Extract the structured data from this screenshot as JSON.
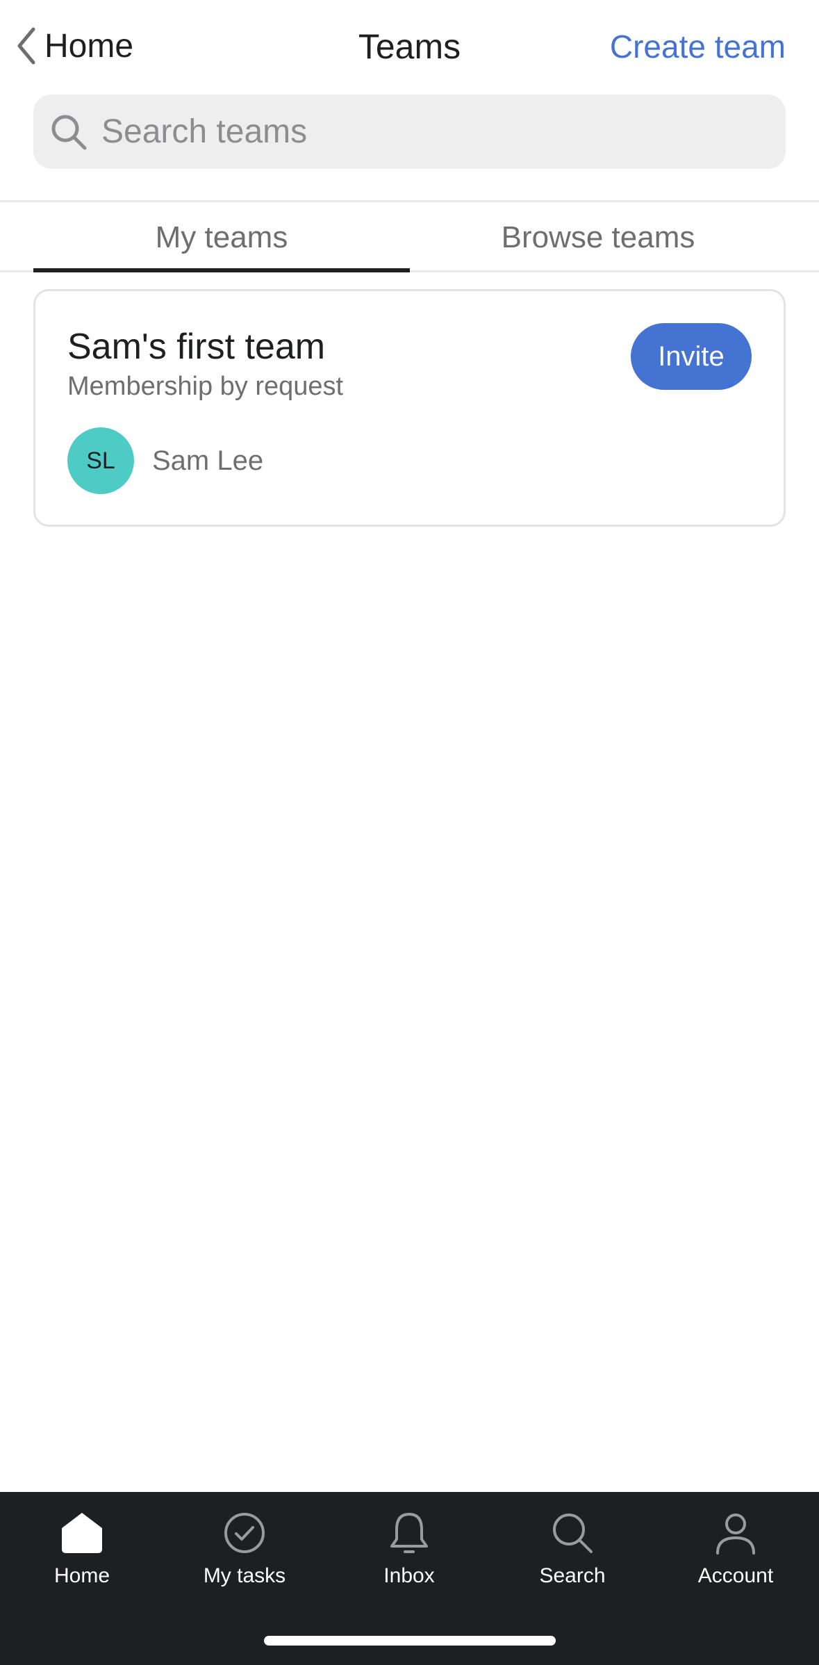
{
  "header": {
    "back_label": "Home",
    "title": "Teams",
    "create_label": "Create team"
  },
  "search": {
    "placeholder": "Search teams",
    "value": ""
  },
  "tabs": [
    {
      "label": "My teams",
      "active": true
    },
    {
      "label": "Browse teams",
      "active": false
    }
  ],
  "team_card": {
    "name": "Sam's first team",
    "membership": "Membership by request",
    "invite_label": "Invite",
    "members": [
      {
        "initials": "SL",
        "name": "Sam Lee",
        "avatar_color": "#4ecbc4"
      }
    ]
  },
  "bottom_nav": [
    {
      "label": "Home",
      "icon": "home-icon",
      "active": true
    },
    {
      "label": "My tasks",
      "icon": "check-circle-icon",
      "active": false
    },
    {
      "label": "Inbox",
      "icon": "bell-icon",
      "active": false
    },
    {
      "label": "Search",
      "icon": "search-icon",
      "active": false
    },
    {
      "label": "Account",
      "icon": "person-icon",
      "active": false
    }
  ],
  "colors": {
    "accent": "#4573d2",
    "text": "#1e1f21",
    "muted": "#6d6e6f",
    "nav_background": "#1e1f21",
    "search_background": "#eeeeee"
  }
}
